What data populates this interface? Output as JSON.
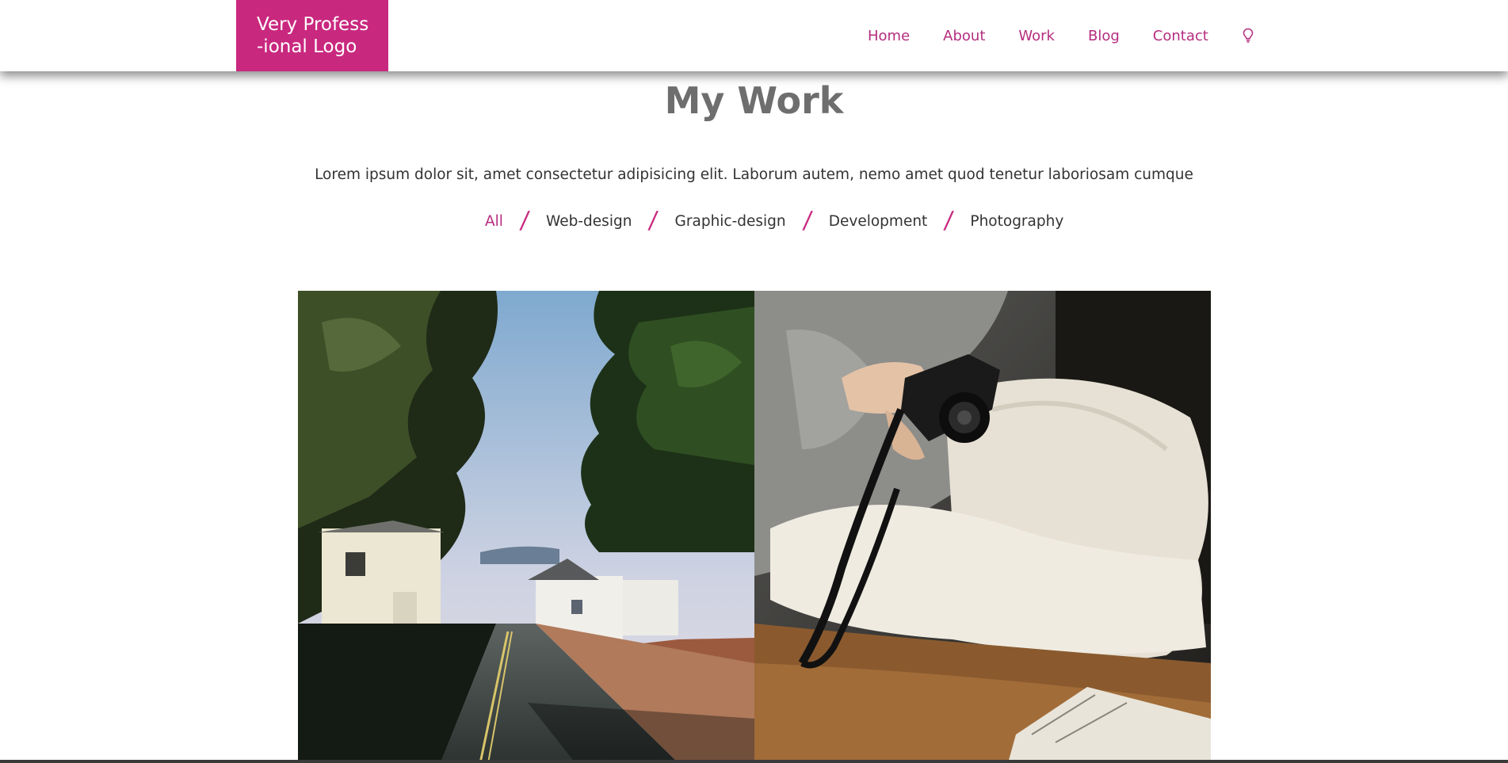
{
  "header": {
    "logo_line1": "Very Profess",
    "logo_line2": "-ional Logo",
    "nav": [
      {
        "label": "Home"
      },
      {
        "label": "About"
      },
      {
        "label": "Work"
      },
      {
        "label": "Blog"
      },
      {
        "label": "Contact"
      }
    ],
    "theme_icon": "lightbulb-icon"
  },
  "main": {
    "title": "My Work",
    "subtitle": "Lorem ipsum dolor sit, amet consectetur adipisicing elit. Laborum autem, nemo amet quod tenetur laboriosam cumque",
    "filters": [
      {
        "label": "All",
        "active": true
      },
      {
        "label": "Web-design",
        "active": false
      },
      {
        "label": "Graphic-design",
        "active": false
      },
      {
        "label": "Development",
        "active": false
      },
      {
        "label": "Photography",
        "active": false
      }
    ],
    "separator": "/"
  },
  "colors": {
    "accent": "#c9287f",
    "nav_text": "#b52d7f",
    "title": "#6e6e6e",
    "body_text": "#333333"
  }
}
